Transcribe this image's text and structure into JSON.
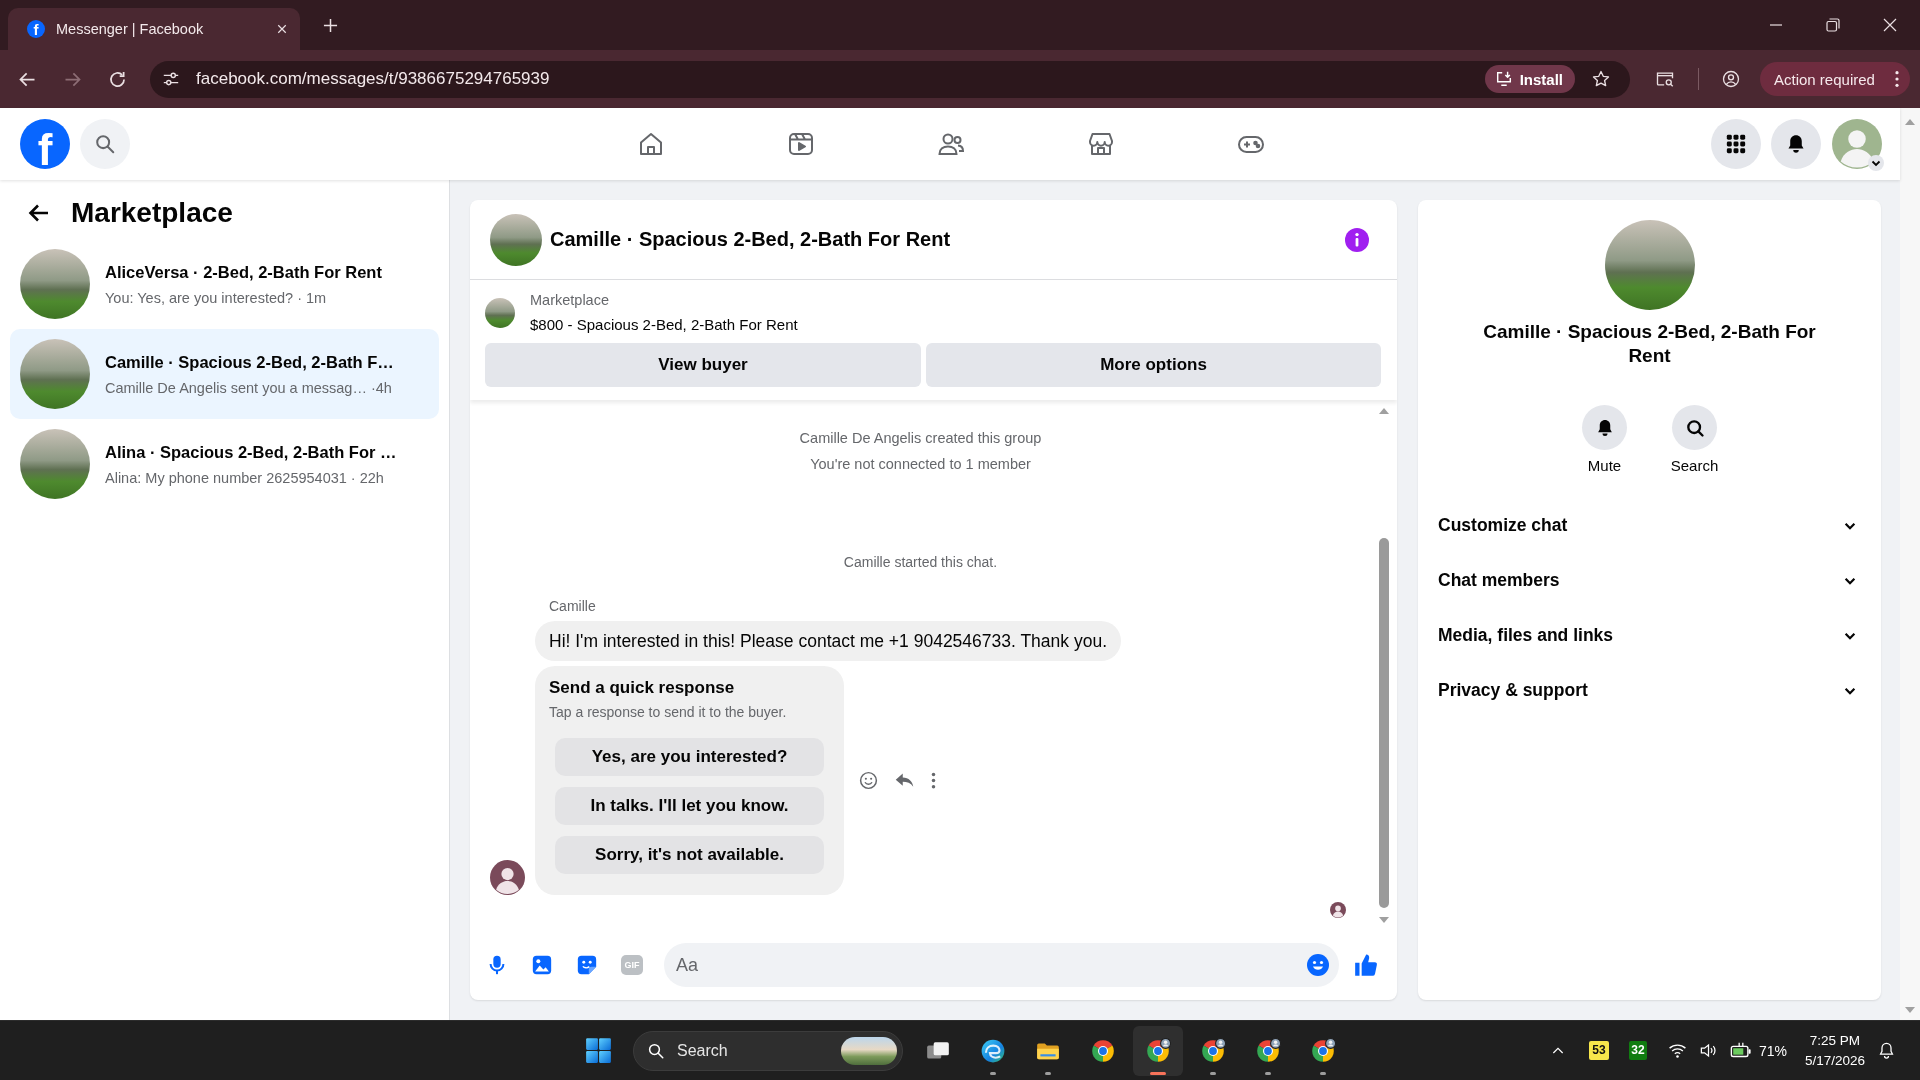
{
  "browser": {
    "tabs": [
      {
        "favicon": "f",
        "title": "Messenger | Facebook",
        "selected": true
      }
    ],
    "nav": [
      {
        "kind": "back",
        "disabled": false
      },
      {
        "kind": "forward",
        "disabled": true
      },
      {
        "kind": "reload",
        "disabled": false
      }
    ],
    "url": "facebook.com/messages/t/9386675294765939",
    "install": "Install",
    "profile_status": "Action required"
  },
  "header": {
    "logo": "f",
    "nav": [
      {
        "kind": "home",
        "selected": false
      },
      {
        "kind": "video",
        "selected": false
      },
      {
        "kind": "friends",
        "selected": false
      },
      {
        "kind": "marketplace",
        "selected": false
      },
      {
        "kind": "gaming",
        "selected": false
      }
    ]
  },
  "sidebar": {
    "title": "Marketplace",
    "conversations": [
      {
        "name": "AliceVersa · 2-Bed, 2-Bath For Rent",
        "preview": "You: Yes, are you interested? · 1m",
        "selected": false
      },
      {
        "name": "Camille · Spacious 2-Bed, 2-Bath F…",
        "preview": "Camille De Angelis sent you a messag… ·4h",
        "selected": true
      },
      {
        "name": "Alina · Spacious 2-Bed, 2-Bath For …",
        "preview": "Alina: My phone number 2625954031 · 22h",
        "selected": false
      }
    ]
  },
  "chat": {
    "title": "Camille · Spacious 2-Bed, 2-Bath For Rent",
    "listing": {
      "source": "Marketplace",
      "summary": "$800 - Spacious 2-Bed, 2-Bath For Rent"
    },
    "listing_actions": [
      "View buyer",
      "More options"
    ],
    "events": [
      "Camille De Angelis created this group",
      "You're not connected to 1 member"
    ],
    "start_notice": "Camille started this chat.",
    "sender": "Camille",
    "message": "Hi! I'm interested in this! Please contact me +1 9042546733. Thank you.",
    "quick_response": {
      "title": "Send a quick response",
      "hint": "Tap a response to send it to the buyer.",
      "options": [
        "Yes, are you interested?",
        "In talks. I'll let you know.",
        "Sorry, it's not available."
      ]
    },
    "tools": [
      {
        "kind": "mic"
      },
      {
        "kind": "image"
      },
      {
        "kind": "sticker"
      },
      {
        "kind": "gif",
        "label": "GIF"
      }
    ],
    "composer": {
      "placeholder": "Aa"
    }
  },
  "details": {
    "title": "Camille · Spacious 2-Bed, 2-Bath For Rent",
    "actions": [
      {
        "kind": "mute",
        "label": "Mute"
      },
      {
        "kind": "search",
        "label": "Search"
      }
    ],
    "sections": [
      {
        "label": "Customize chat",
        "expanded": false
      },
      {
        "label": "Chat members",
        "expanded": false
      },
      {
        "label": "Media, files and links",
        "expanded": false
      },
      {
        "label": "Privacy & support",
        "expanded": false
      }
    ]
  },
  "taskbar": {
    "search": {
      "placeholder": "Search"
    },
    "apps": [
      {
        "kind": "task-view",
        "open": false,
        "selected": false
      },
      {
        "kind": "edge",
        "open": true,
        "selected": false
      },
      {
        "kind": "explorer",
        "open": true,
        "selected": false
      },
      {
        "kind": "chrome",
        "open": false,
        "selected": false
      },
      {
        "kind": "chrome-profile",
        "open": true,
        "selected": true
      },
      {
        "kind": "chrome-profile",
        "open": true,
        "selected": false
      },
      {
        "kind": "chrome-profile",
        "open": true,
        "selected": false
      },
      {
        "kind": "chrome-profile",
        "open": true,
        "selected": false
      }
    ],
    "tray": {
      "badges": [
        {
          "text": "53",
          "color": "#f7e64b"
        },
        {
          "text": "32",
          "color": "#107c10"
        }
      ],
      "battery": "71%",
      "time": "7:25 PM",
      "date": "5/17/2026"
    }
  }
}
